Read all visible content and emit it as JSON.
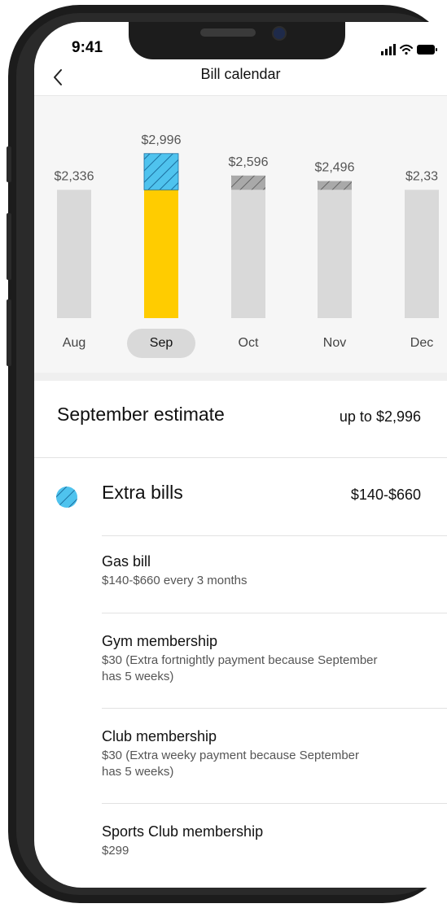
{
  "status_bar": {
    "time": "9:41"
  },
  "nav": {
    "title": "Bill calendar",
    "back_icon": "chevron-left-icon"
  },
  "colors": {
    "accent_yellow": "#FFCC00",
    "extra_blue": "#4FC3EE",
    "hatch_gray": "#A9A9A9",
    "bar_gray": "#D9D9D9"
  },
  "chart_data": {
    "type": "bar",
    "categories": [
      "Aug",
      "Sep",
      "Oct",
      "Nov",
      "Dec"
    ],
    "values": [
      2336,
      2996,
      2596,
      2496,
      2336
    ],
    "value_labels": [
      "$2,336",
      "$2,996",
      "$2,596",
      "$2,496",
      "$2,33"
    ],
    "selected_month": "Sep",
    "series_segments": [
      {
        "category": "Sep",
        "base": 2336,
        "extra": 660,
        "style": "blue-hatched"
      },
      {
        "category": "Oct",
        "base": 2336,
        "extra": 260,
        "style": "gray-hatched"
      },
      {
        "category": "Nov",
        "base": 2336,
        "extra": 160,
        "style": "gray-hatched"
      }
    ],
    "ylim": [
      0,
      3400
    ]
  },
  "estimate": {
    "label": "September estimate",
    "value": "up to $2,996"
  },
  "extra_bills": {
    "icon": "blue-hatched-dot-icon",
    "label": "Extra bills",
    "value": "$140-$660",
    "items": [
      {
        "name": "Gas bill",
        "desc": "$140-$660 every 3 months"
      },
      {
        "name": "Gym membership",
        "desc": "$30 (Extra fortnightly payment because September has 5 weeks)"
      },
      {
        "name": "Club membership",
        "desc": "$30 (Extra weeky payment because September has 5 weeks)"
      },
      {
        "name": "Sports Club membership",
        "desc": "$299"
      }
    ]
  }
}
